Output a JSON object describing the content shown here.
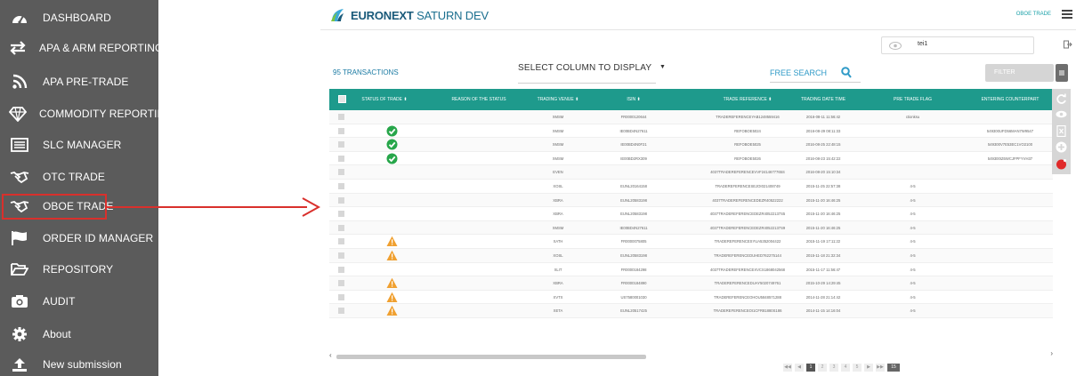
{
  "sidebar": {
    "items": [
      {
        "label": "DASHBOARD",
        "icon": "dashboard-gauge-icon"
      },
      {
        "label": "APA & ARM REPORTING",
        "icon": "swap-arrows-icon"
      },
      {
        "label": "APA PRE-TRADE",
        "icon": "rss-feed-icon"
      },
      {
        "label": "COMMODITY REPORTING",
        "icon": "diamond-icon"
      },
      {
        "label": "SLC MANAGER",
        "icon": "list-icon"
      },
      {
        "label": "OTC TRADE",
        "icon": "handshake-icon"
      },
      {
        "label": "OBOE TRADE",
        "icon": "handshake-icon"
      },
      {
        "label": "ORDER ID MANAGER",
        "icon": "flag-icon"
      },
      {
        "label": "REPOSITORY",
        "icon": "folder-open-icon"
      },
      {
        "label": "AUDIT",
        "icon": "camera-icon"
      },
      {
        "label": "About",
        "icon": "gear-icon"
      },
      {
        "label": "New submission",
        "icon": "upload-icon"
      }
    ],
    "active_index": 6,
    "highlight_color": "#d9302c"
  },
  "header": {
    "brand": "EURONEXT",
    "env": "SATURN DEV",
    "breadcrumb": "OBOE TRADE"
  },
  "identity_field": {
    "value": "tei1"
  },
  "toolbar": {
    "transactions": "95 TRANSACTIONS",
    "column_select": "SELECT COLUMN TO DISPLAY",
    "free_search": "FREE SEARCH",
    "filter_placeholder": "FILTER"
  },
  "table": {
    "header_color": "#1e9a8c",
    "columns": [
      "STATUS OF TRADE ⬍",
      "REASON OF THE STATUS",
      "TRADING VENUE ⬍",
      "ISIN ⬍",
      "TRADE REFERENCE ⬍",
      "TRADING DATE TIME",
      "PRE TRADE FLAG",
      "ENTERING COUNTERPART"
    ],
    "rows": [
      {
        "status": "",
        "venue": "XMSM",
        "isin": "FR0000120644",
        "ref": "TRADEREFERENCEYAB1248559416",
        "datetime": "2016-08-11 11:56:42",
        "flag": "ctionksu",
        "counterpart": ""
      },
      {
        "status": "ok",
        "venue": "XMSM",
        "isin": "IE00BD4N27611",
        "ref": "REFOBOE5024",
        "datetime": "2016-08-29 08:11:33",
        "flag": "",
        "counterpart": "549300UFD56MAN7W9547"
      },
      {
        "status": "ok",
        "venue": "XMSM",
        "isin": "IE00BD4N0F21",
        "ref": "REFOBOE5025",
        "datetime": "2016-08-25 22:48:15",
        "flag": "",
        "counterpart": "549300V7E53EC1VO2100"
      },
      {
        "status": "ok",
        "venue": "XMSM",
        "isin": "IE00BD2RX309",
        "ref": "REFOBOE5026",
        "datetime": "2016-08-23 15:42:22",
        "flag": "",
        "counterpart": "549300IZ6WCJFPFYVH37"
      },
      {
        "status": "",
        "venue": "EVEN",
        "isin": "",
        "ref": "4037TRADEREFERENCEVVF2414677765S",
        "datetime": "2016-08-20 15:10:34",
        "flag": "",
        "counterpart": ""
      },
      {
        "status": "",
        "venue": "XOSL",
        "isin": "EUNL20164158",
        "ref": "TRADEREFERENCESEJOI021408749",
        "datetime": "2015-11-25 22:57:38",
        "flag": "4-5",
        "counterpart": ""
      },
      {
        "status": "",
        "venue": "XBRA",
        "isin": "EUNL20583198",
        "ref": "4037TRADEREFERENCEDEZR40522222",
        "datetime": "2015-11-20 16:46:25",
        "flag": "4-5",
        "counterpart": ""
      },
      {
        "status": "",
        "venue": "XBRA",
        "isin": "EUNL20583198",
        "ref": "4037TRADEREFERENCEDEZR40522137S5",
        "datetime": "2015-11-20 16:46:25",
        "flag": "4-5",
        "counterpart": ""
      },
      {
        "status": "",
        "venue": "XMSM",
        "isin": "IE00BD4N27611",
        "ref": "4037TRADEREFERENCEDEZR40522137S9",
        "datetime": "2015-11-20 16:46:25",
        "flag": "4-5",
        "counterpart": ""
      },
      {
        "status": "warn",
        "venue": "XATH",
        "isin": "FR0000075805",
        "ref": "TRADEREFERENCESYUA5352004422",
        "datetime": "2015-11-19 17:11:22",
        "flag": "4-5",
        "counterpart": ""
      },
      {
        "status": "warn",
        "venue": "XOSL",
        "isin": "EUNL20583198",
        "ref": "TRADEREFERENCEDUHED762275144",
        "datetime": "2015-11-18 21:32:34",
        "flag": "4-5",
        "counterpart": ""
      },
      {
        "status": "",
        "venue": "XLIT",
        "isin": "FR0000184298",
        "ref": "4037TRADEREFERENCEXVCS1868042568",
        "datetime": "2015-11-17 11:56:47",
        "flag": "4-5",
        "counterpart": ""
      },
      {
        "status": "warn",
        "venue": "XBRA",
        "isin": "FR0000184890",
        "ref": "TRADEREFERENCEDUAY5020749761",
        "datetime": "2015-10-29 14:29:45",
        "flag": "4-5",
        "counterpart": ""
      },
      {
        "status": "warn",
        "venue": "XVTX",
        "isin": "US7580001030",
        "ref": "TRADEREFERENCEOHOU5848571288",
        "datetime": "2014-11-28 21:14:42",
        "flag": "4-5",
        "counterpart": ""
      },
      {
        "status": "warn",
        "venue": "XETA",
        "isin": "EUNL20517425",
        "ref": "TRADEREFERENCEOI1CFR81880S186",
        "datetime": "2014-11-15 14:16:04",
        "flag": "4-5",
        "counterpart": ""
      }
    ]
  },
  "pager": {
    "pages": [
      "1",
      "2",
      "3",
      "4",
      "5"
    ],
    "current": "1",
    "page_size": "15"
  },
  "colors": {
    "ok": "#27a64a",
    "warn": "#f0a030",
    "accent": "#1e9a8c",
    "sidebar_bg": "#5b5b5b"
  }
}
